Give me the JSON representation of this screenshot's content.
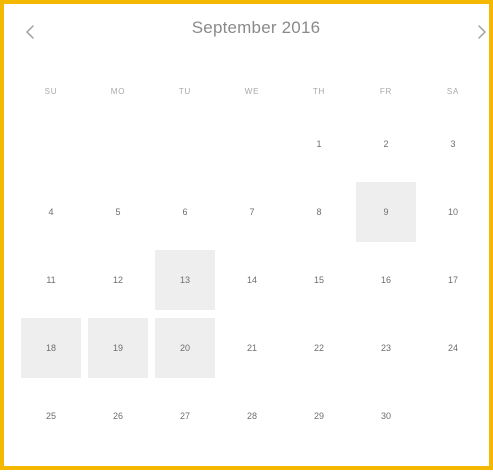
{
  "calendar": {
    "title": "September 2016",
    "prev_icon": "chevron-left-icon",
    "next_icon": "chevron-right-icon",
    "weekdays": [
      "SU",
      "MO",
      "TU",
      "WE",
      "TH",
      "FR",
      "SA"
    ],
    "leading_blanks": 4,
    "days": [
      {
        "label": "1",
        "selected": false
      },
      {
        "label": "2",
        "selected": false
      },
      {
        "label": "3",
        "selected": false
      },
      {
        "label": "4",
        "selected": false
      },
      {
        "label": "5",
        "selected": false
      },
      {
        "label": "6",
        "selected": false
      },
      {
        "label": "7",
        "selected": false
      },
      {
        "label": "8",
        "selected": false
      },
      {
        "label": "9",
        "selected": true
      },
      {
        "label": "10",
        "selected": false
      },
      {
        "label": "11",
        "selected": false
      },
      {
        "label": "12",
        "selected": false
      },
      {
        "label": "13",
        "selected": true
      },
      {
        "label": "14",
        "selected": false
      },
      {
        "label": "15",
        "selected": false
      },
      {
        "label": "16",
        "selected": false
      },
      {
        "label": "17",
        "selected": false
      },
      {
        "label": "18",
        "selected": true
      },
      {
        "label": "19",
        "selected": true
      },
      {
        "label": "20",
        "selected": true
      },
      {
        "label": "21",
        "selected": false
      },
      {
        "label": "22",
        "selected": false
      },
      {
        "label": "23",
        "selected": false
      },
      {
        "label": "24",
        "selected": false
      },
      {
        "label": "25",
        "selected": false
      },
      {
        "label": "26",
        "selected": false
      },
      {
        "label": "27",
        "selected": false
      },
      {
        "label": "28",
        "selected": false
      },
      {
        "label": "29",
        "selected": false
      },
      {
        "label": "30",
        "selected": false
      }
    ],
    "colors": {
      "frame_border": "#f5b800",
      "selected_bg": "#eeeeee",
      "text": "#6e6e6e",
      "muted": "#a8a8a8"
    }
  }
}
